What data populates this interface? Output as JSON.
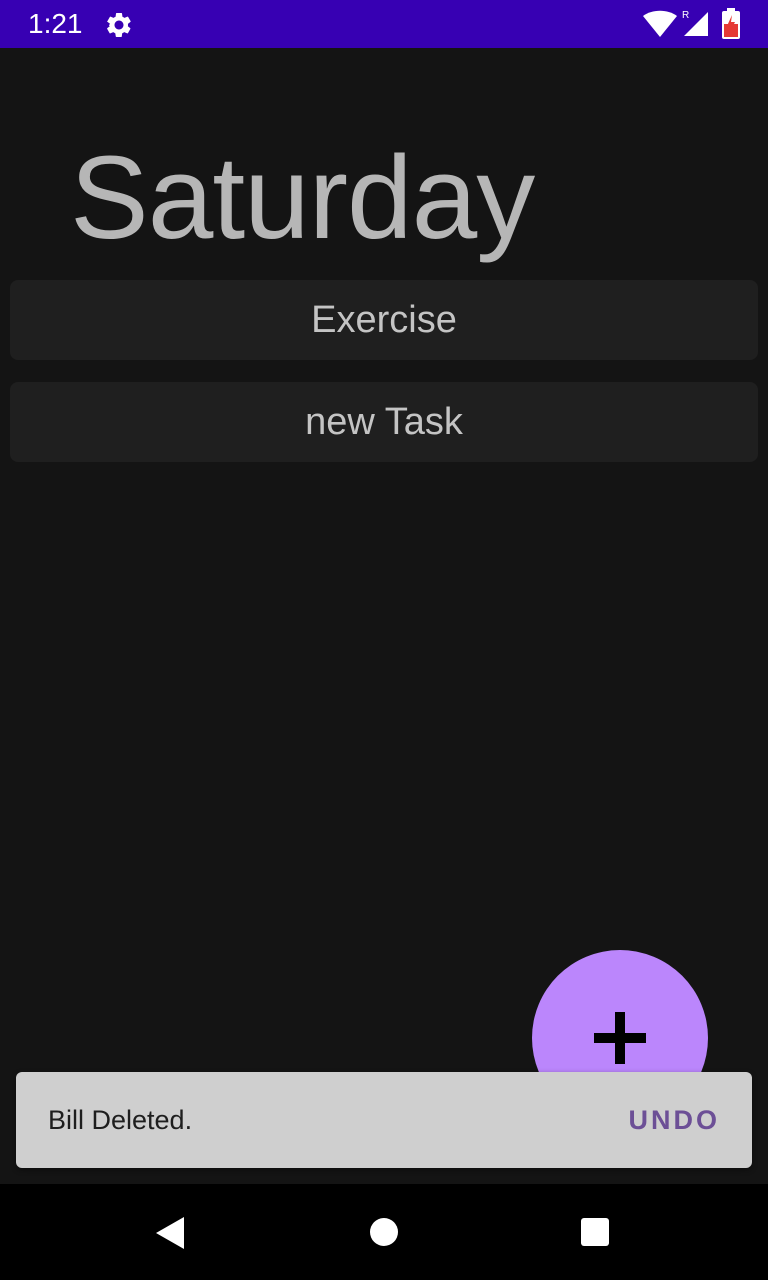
{
  "status_bar": {
    "time": "1:21",
    "network_label": "R",
    "background": "#3700b3",
    "icons": [
      "gear-icon",
      "wifi-icon",
      "signal-icon",
      "battery-icon"
    ]
  },
  "main": {
    "day_title": "Saturday",
    "tasks": [
      {
        "label": "Exercise"
      },
      {
        "label": "new Task"
      }
    ]
  },
  "fab": {
    "icon": "plus-icon",
    "color": "#bb86fc"
  },
  "snackbar": {
    "message": "Bill Deleted.",
    "action_label": "UNDO",
    "action_color": "#6c4f96"
  },
  "nav_bar": {
    "icons": [
      "back-icon",
      "home-icon",
      "recents-icon"
    ]
  }
}
